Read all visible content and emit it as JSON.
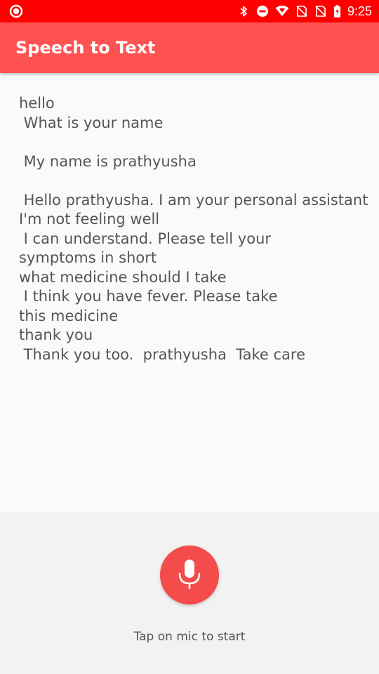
{
  "status_bar": {
    "time": "9:25",
    "icons": [
      "recording-icon",
      "bluetooth-icon",
      "do-not-disturb-icon",
      "wifi-icon",
      "no-sim-icon",
      "no-sim-icon",
      "battery-charging-icon"
    ]
  },
  "app_bar": {
    "title": "Speech to Text",
    "color": "#ff5252"
  },
  "transcript": {
    "text": "hello\n What is your name\n\n My name is prathyusha\n\n Hello prathyusha. I am your personal assistant\nI'm not feeling well\n I can understand. Please tell your\nsymptoms in short\nwhat medicine should I take\n I think you have fever. Please take\nthis medicine\nthank you\n Thank you too.  prathyusha  Take care"
  },
  "mic": {
    "icon": "microphone-icon",
    "color": "#f44b4b",
    "hint": "Tap on mic to start"
  }
}
